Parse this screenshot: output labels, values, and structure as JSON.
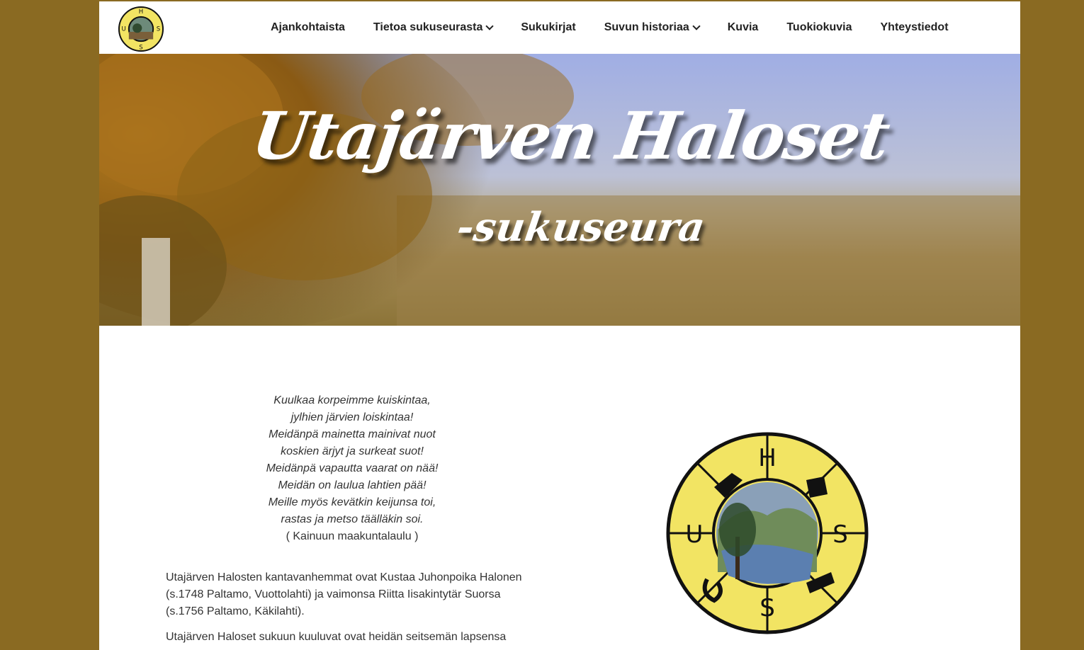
{
  "emblem": {
    "letters": [
      "H",
      "U",
      "S",
      "S"
    ],
    "ring_color": "#f2e463",
    "outline_color": "#111111"
  },
  "nav": {
    "items": [
      {
        "label": "Ajankohtaista",
        "dropdown": false
      },
      {
        "label": "Tietoa sukuseurasta",
        "dropdown": true
      },
      {
        "label": "Sukukirjat",
        "dropdown": false
      },
      {
        "label": "Suvun historiaa",
        "dropdown": true
      },
      {
        "label": "Kuvia",
        "dropdown": false
      },
      {
        "label": "Tuokiokuvia",
        "dropdown": false
      },
      {
        "label": "Yhteystiedot",
        "dropdown": false
      }
    ]
  },
  "hero": {
    "title": "Utajärven Haloset",
    "subtitle": "-sukuseura"
  },
  "poem": {
    "lines": [
      "Kuulkaa korpeimme kuiskintaa,",
      "jylhien järvien loiskintaa!",
      "Meidänpä mainetta mainivat nuot",
      "koskien ärjyt ja surkeat suot!",
      "Meidänpä vapautta vaarat on nää!",
      "Meidän on laulua lahtien pää!",
      "Meille myös kevätkin keijunsa toi,",
      "rastas ja metso täälläkin soi."
    ],
    "source": "( Kainuun maakuntalaulu )"
  },
  "content": {
    "paragraph1": "Utajärven Halosten kantavanhemmat ovat Kustaa Juhonpoika Halonen (s.1748 Paltamo, Vuottolahti) ja vaimonsa Riitta Iisakintytär Suorsa (s.1756 Paltamo, Käkilahti).",
    "paragraph2": "Utajärven Haloset sukuun kuuluvat ovat heidän seitsemän lapsensa"
  },
  "colors": {
    "outer_background": "#8a6a22",
    "page_background": "#ffffff",
    "text": "#333333",
    "nav_text": "#222222"
  }
}
